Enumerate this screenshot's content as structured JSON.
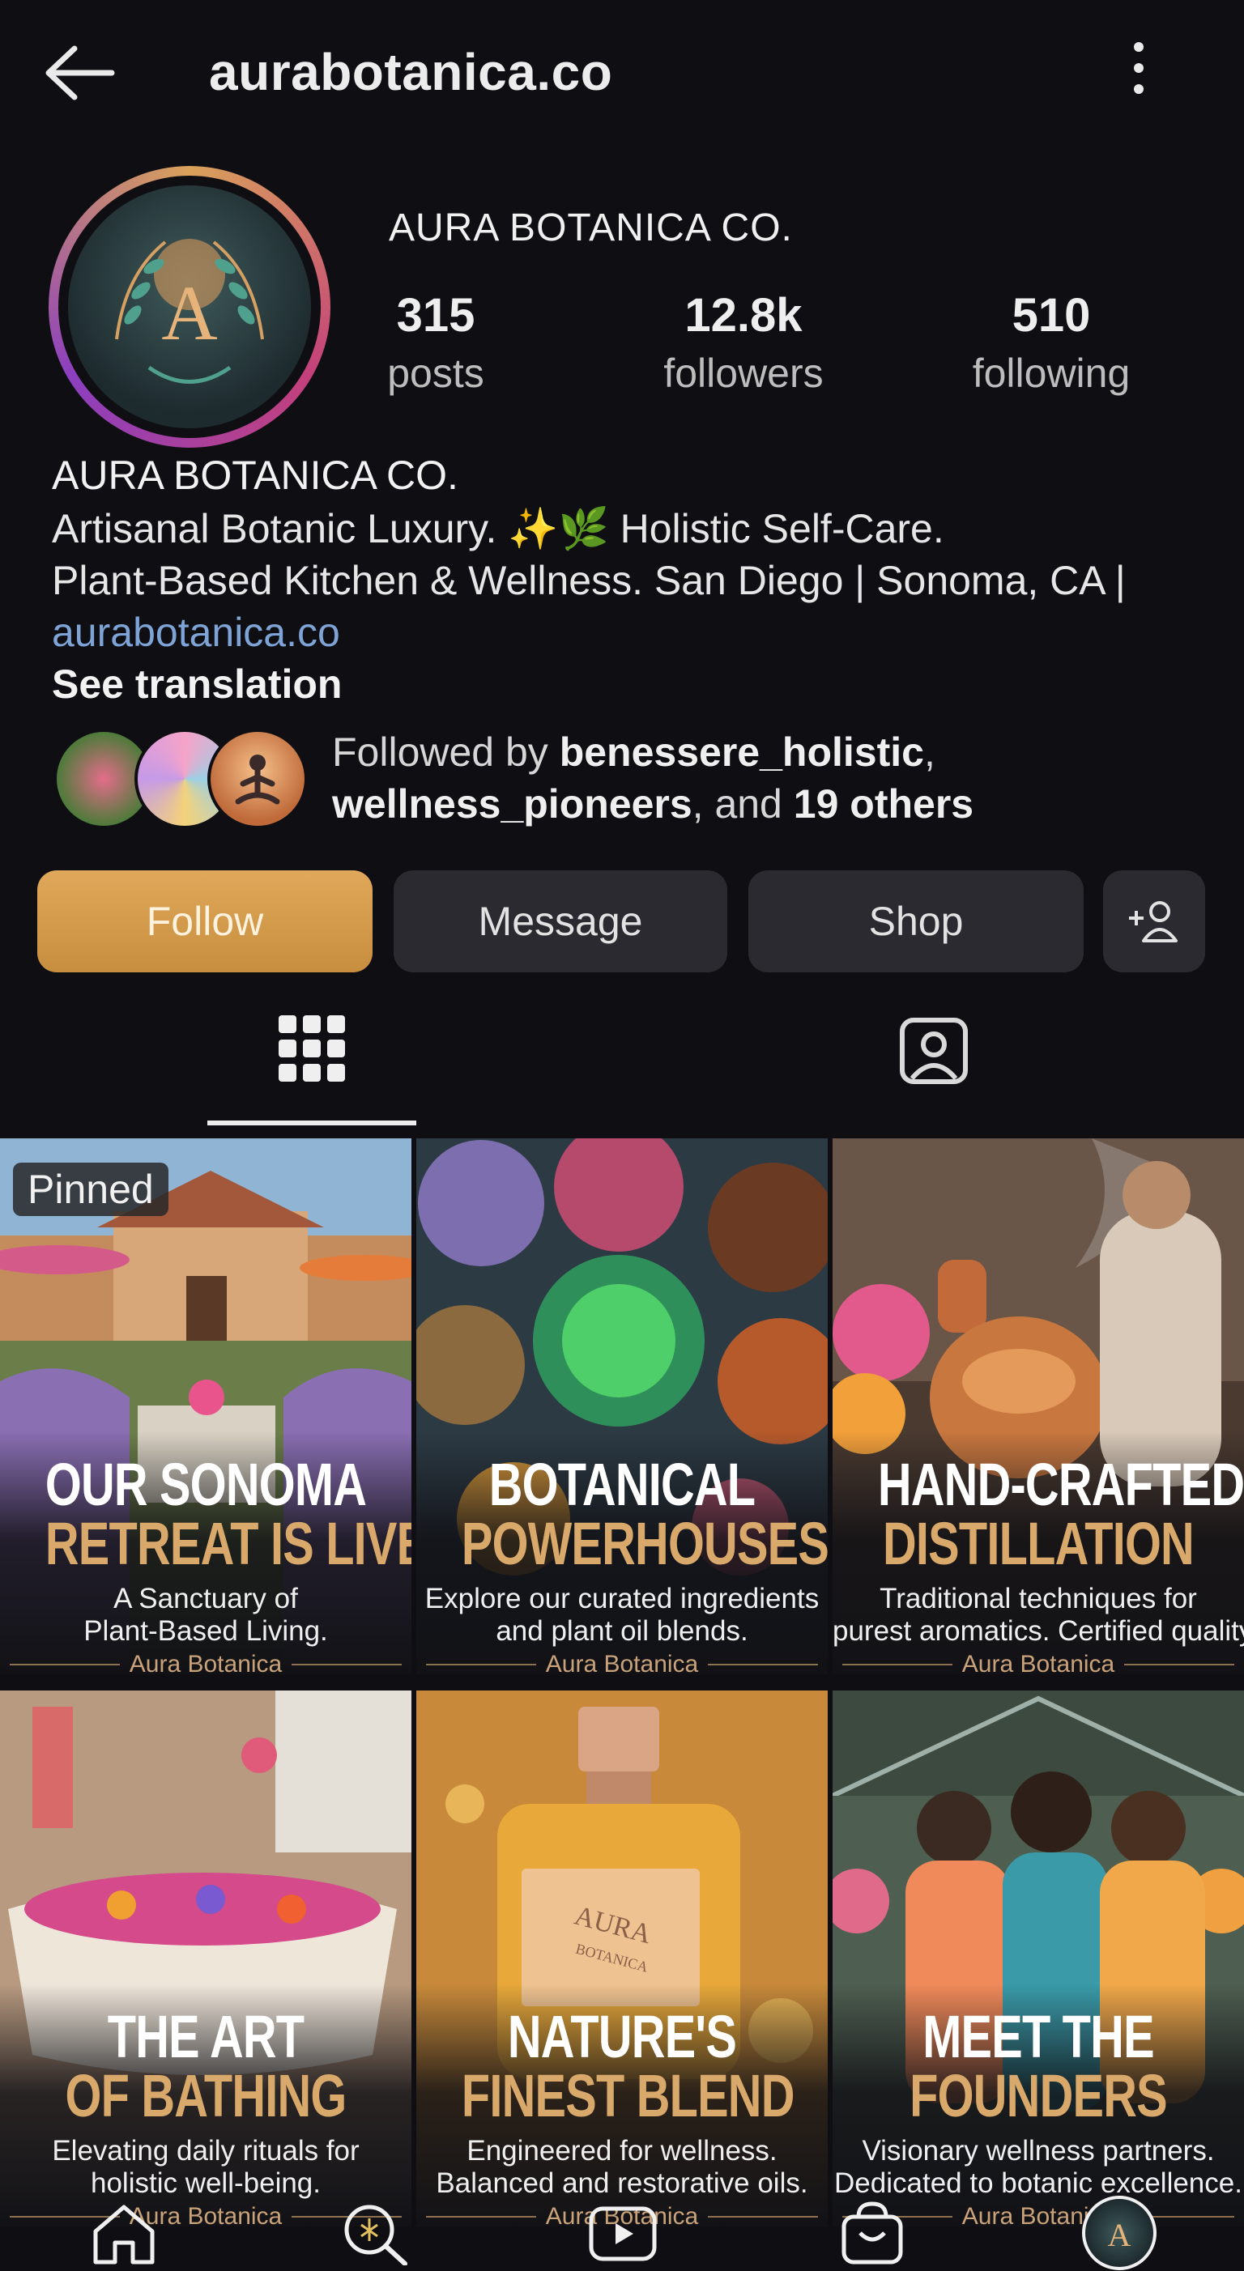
{
  "header": {
    "handle": "aurabotanica.co"
  },
  "profile": {
    "display_name": "AURA BOTANICA CO.",
    "stats": [
      {
        "value": "315",
        "label": "posts"
      },
      {
        "value": "12.8k",
        "label": "followers"
      },
      {
        "value": "510",
        "label": "following"
      }
    ],
    "bio_name": "AURA BOTANICA CO.",
    "bio_line1": "Artisanal Botanic Luxury. ✨🌿 Holistic Self-Care.",
    "bio_line2": "Plant-Based Kitchen & Wellness. San Diego | Sonoma, CA |",
    "bio_link": "aurabotanica.co",
    "see_translation": "See translation",
    "followed_by": {
      "prefix": "Followed by ",
      "user1": "benessere_holistic",
      "sep1": ",",
      "user2": "wellness_pioneers",
      "sep2": ", and ",
      "others": "19 others"
    }
  },
  "actions": {
    "follow": "Follow",
    "message": "Message",
    "shop": "Shop"
  },
  "posts": [
    {
      "pinned": "Pinned",
      "title1": "OUR SONOMA",
      "title2": "RETREAT IS LIVE",
      "sub1": "A Sanctuary of",
      "sub2": "Plant-Based Living.",
      "brand": "Aura Botanica"
    },
    {
      "title1": "BOTANICAL",
      "title2": "POWERHOUSES",
      "sub1": "Explore our curated ingredients",
      "sub2": "and plant oil blends.",
      "brand": "Aura Botanica"
    },
    {
      "title1": "HAND-CRAFTED",
      "title2": "DISTILLATION",
      "sub1": "Traditional techniques for",
      "sub2": "purest aromatics. Certified quality.",
      "brand": "Aura Botanica"
    },
    {
      "title1": "THE ART",
      "title2": "OF BATHING",
      "sub1": "Elevating daily rituals for",
      "sub2": "holistic well-being.",
      "brand": "Aura Botanica"
    },
    {
      "title1": "NATURE'S",
      "title2": "FINEST BLEND",
      "sub1": "Engineered for wellness.",
      "sub2": "Balanced and restorative oils.",
      "brand": "Aura Botanica",
      "bottle_label1": "AURA",
      "bottle_label2": "BOTANICA"
    },
    {
      "title1": "MEET THE",
      "title2": "FOUNDERS",
      "sub1": "Visionary wellness partners.",
      "sub2": "Dedicated to botanic excellence.",
      "brand": "Aura Botanica"
    }
  ],
  "bottom_nav": [
    "home-icon",
    "search-icon",
    "reels-icon",
    "shop-icon",
    "profile-avatar"
  ]
}
